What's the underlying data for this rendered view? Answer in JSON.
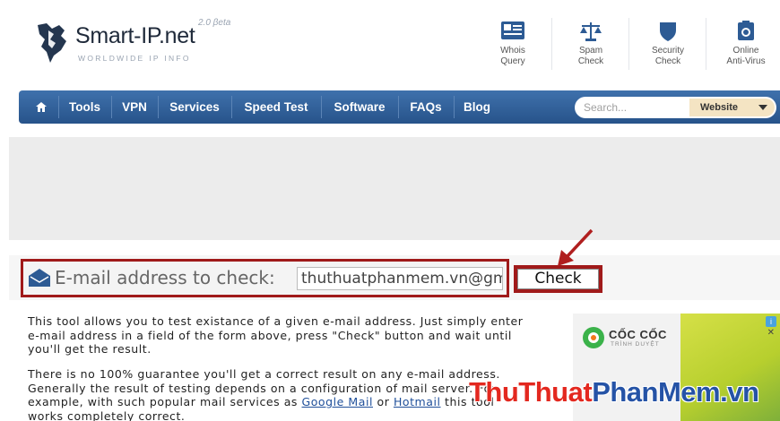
{
  "brand": {
    "name": "Smart-IP.net",
    "subtitle": "WORLDWIDE IP INFO",
    "version": "2.0 βeta"
  },
  "toolbar": [
    {
      "icon": "whois-icon",
      "line1": "Whois",
      "line2": "Query"
    },
    {
      "icon": "scales-icon",
      "line1": "Spam",
      "line2": "Check"
    },
    {
      "icon": "shield-icon",
      "line1": "Security",
      "line2": "Check"
    },
    {
      "icon": "camera-icon",
      "line1": "Online",
      "line2": "Anti-Virus"
    }
  ],
  "nav": {
    "home_icon": "home-icon",
    "items": [
      "Tools",
      "VPN",
      "Services",
      "Speed Test",
      "Software",
      "FAQs",
      "Blog"
    ],
    "search_placeholder": "Search...",
    "search_scope": "Website",
    "bar_color": "#2d5b94"
  },
  "email_check": {
    "label": "E-mail address to check:",
    "value": "thuthuatphanmem.vn@gmail.com",
    "button": "Check",
    "highlight_color": "#a01a1a"
  },
  "description": {
    "p1": "This tool allows you to test existance of a given e-mail address. Just simply enter e-mail address in a field of the form above, press \"Check\" button and wait until you'll get the result.",
    "p2_part1": "There is no 100% guarantee you'll get a correct result on any e-mail address. Generally the result of testing depends on a configuration of mail server. For example, with such popular mail services as ",
    "p2_link1": "Google Mail",
    "p2_part2": " or ",
    "p2_link2": "Hotmail",
    "p2_part3": " this tool works completely correct."
  },
  "ad": {
    "brand": "CỐC CỐC",
    "brand_sub": "TRÌNH DUYỆT",
    "info": "i",
    "close": "✕"
  },
  "watermark": {
    "part1": "ThuThuat",
    "part2": "PhanMem",
    "part3": ".vn"
  }
}
